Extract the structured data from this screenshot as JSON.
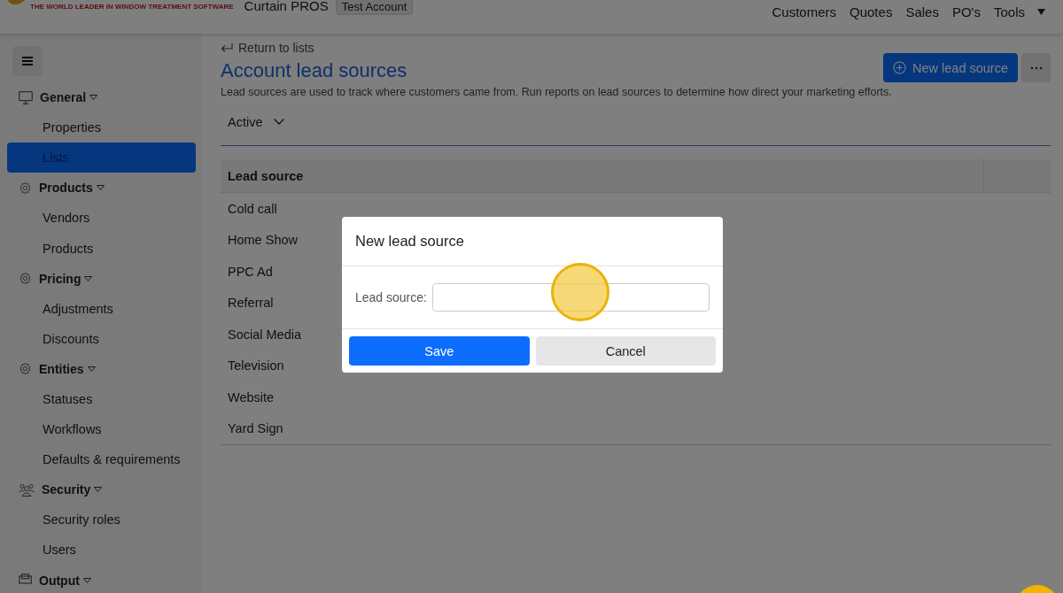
{
  "header": {
    "tagline": "THE WORLD LEADER IN WINDOW TREATMENT SOFTWARE",
    "company": "Curtain PROS",
    "account_badge": "Test Account",
    "nav": [
      {
        "label": "Customers",
        "has_menu": false
      },
      {
        "label": "Quotes",
        "has_menu": false
      },
      {
        "label": "Sales",
        "has_menu": false
      },
      {
        "label": "PO's",
        "has_menu": false
      },
      {
        "label": "Tools",
        "has_menu": true
      }
    ]
  },
  "sidebar": {
    "groups": [
      {
        "label": "General",
        "expanded": true,
        "items": [
          {
            "label": "Properties",
            "selected": false
          },
          {
            "label": "Lists",
            "selected": true
          }
        ]
      },
      {
        "label": "Products",
        "expanded": true,
        "items": [
          {
            "label": "Vendors",
            "selected": false
          },
          {
            "label": "Products",
            "selected": false
          }
        ]
      },
      {
        "label": "Pricing",
        "expanded": true,
        "items": [
          {
            "label": "Adjustments",
            "selected": false
          },
          {
            "label": "Discounts",
            "selected": false
          }
        ]
      },
      {
        "label": "Entities",
        "expanded": true,
        "items": [
          {
            "label": "Statuses",
            "selected": false
          },
          {
            "label": "Workflows",
            "selected": false
          },
          {
            "label": "Defaults & requirements",
            "selected": false
          }
        ]
      },
      {
        "label": "Security",
        "expanded": true,
        "items": [
          {
            "label": "Security roles",
            "selected": false
          },
          {
            "label": "Users",
            "selected": false
          }
        ]
      },
      {
        "label": "Output",
        "expanded": true
      }
    ]
  },
  "main": {
    "back_link": "Return to lists",
    "title": "Account lead sources",
    "new_button": "New lead source",
    "description": "Lead sources are used to track where customers came from. Run reports on lead sources to determine how direct your marketing efforts.",
    "filter": "Active",
    "table": {
      "columns": [
        "Lead source"
      ],
      "rows": [
        "Cold call",
        "Home Show",
        "PPC Ad",
        "Referral",
        "Social Media",
        "Television",
        "Website",
        "Yard Sign"
      ]
    }
  },
  "dialog": {
    "title": "New lead source",
    "field_label": "Lead source:",
    "buttons": [
      {
        "label": "Save",
        "kind": "primary"
      },
      {
        "label": "Cancel",
        "kind": "secondary"
      }
    ]
  }
}
